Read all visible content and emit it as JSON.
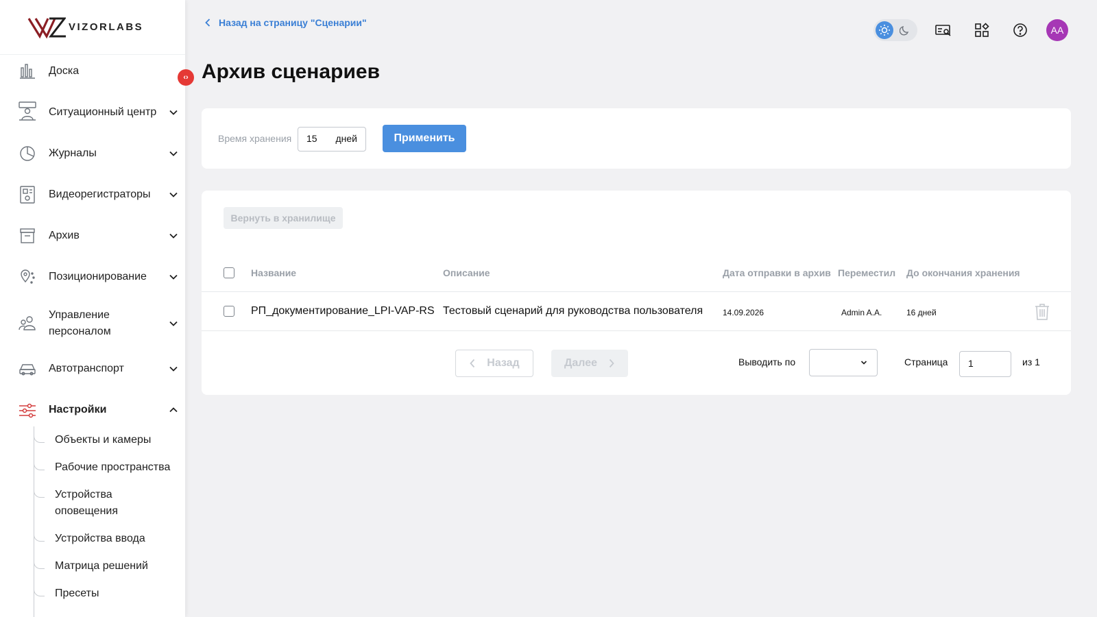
{
  "brand": {
    "name": "VIZORLABS",
    "logo_mark": "VZ",
    "accent_color": "#8b1e24"
  },
  "sidebar": {
    "items": [
      {
        "label": "Доска",
        "icon": "dashboard-chart-icon",
        "expandable": false
      },
      {
        "label": "Ситуационный центр",
        "icon": "situation-center-icon",
        "expandable": true
      },
      {
        "label": "Журналы",
        "icon": "journal-pie-icon",
        "expandable": true
      },
      {
        "label": "Видеорегистраторы",
        "icon": "video-recorder-icon",
        "expandable": true
      },
      {
        "label": "Архив",
        "icon": "archive-box-icon",
        "expandable": true
      },
      {
        "label": "Позиционирование",
        "icon": "location-pin-icon",
        "expandable": true
      },
      {
        "label": "Управление персоналом",
        "icon": "staff-icon",
        "expandable": true
      },
      {
        "label": "Автотранспорт",
        "icon": "car-icon",
        "expandable": true
      },
      {
        "label": "Настройки",
        "icon": "settings-sliders-icon",
        "expandable": true,
        "expanded": true,
        "active": true
      }
    ],
    "settings_subitems": [
      "Объекты и камеры",
      "Рабочие пространства",
      "Устройства оповещения",
      "Устройства ввода",
      "Матрица решений",
      "Пресеты"
    ],
    "collapse_toggle": "‹›"
  },
  "header": {
    "back_link": "Назад на страницу \"Сценарии\"",
    "title": "Архив сценариев",
    "avatar_initials": "AA",
    "theme": "light"
  },
  "retention": {
    "label": "Время хранения",
    "value": "15",
    "unit": "дней",
    "apply_label": "Применить"
  },
  "table": {
    "restore_label": "Вернуть в хранилище",
    "columns": [
      "Название",
      "Описание",
      "Дата отправки в архив",
      "Переместил",
      "До окончания хранения"
    ],
    "rows": [
      {
        "name": "РП_документирование_LPI-VAP-RS",
        "description": "Тестовый сценарий для руководства пользователя",
        "archived_date": "14.09.2026",
        "moved_by": "Admin A.A.",
        "remaining": "16 дней"
      }
    ]
  },
  "pagination": {
    "prev_label": "Назад",
    "next_label": "Далее",
    "per_page_label": "Выводить по",
    "per_page_value": "",
    "page_label": "Страница",
    "page_value": "1",
    "of_label": "из 1"
  }
}
